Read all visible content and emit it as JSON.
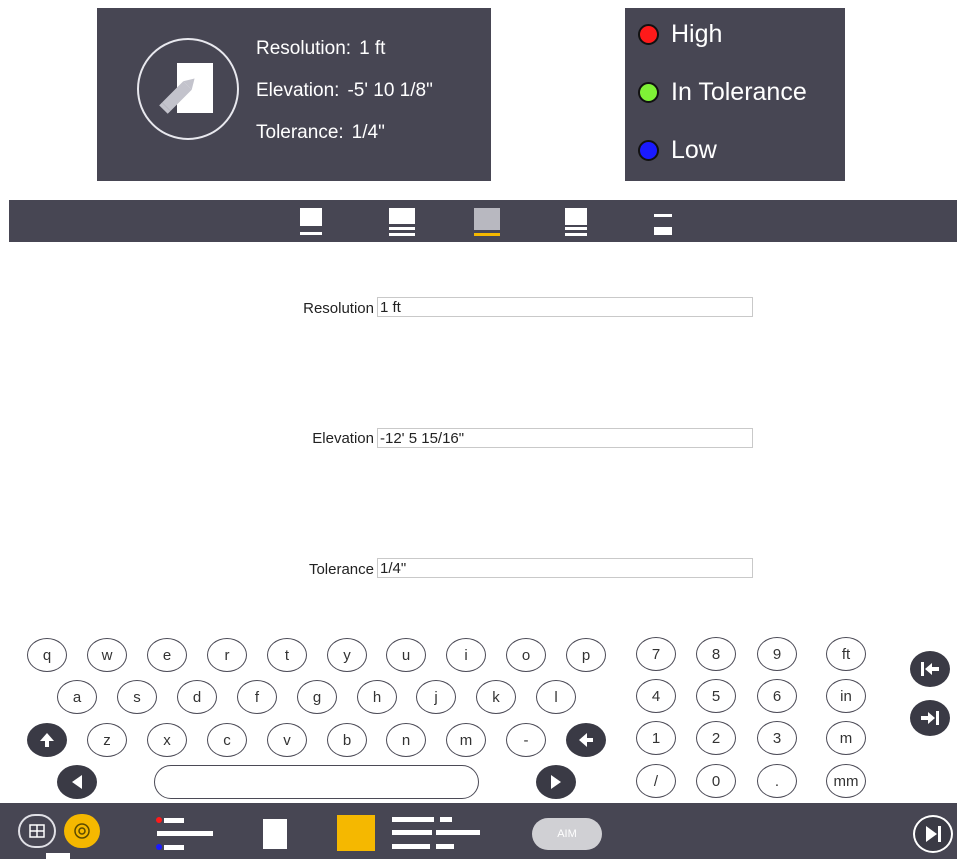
{
  "info_panel": {
    "resolution_label": "Resolution:",
    "resolution_value": "1 ft",
    "elevation_label": "Elevation:",
    "elevation_value": "-5' 10 1/8\"",
    "tolerance_label": "Tolerance:",
    "tolerance_value": "1/4\"",
    "icon": "edit-document-icon"
  },
  "legend": {
    "items": [
      {
        "label": "High",
        "color": "#ff1a1a"
      },
      {
        "label": "In Tolerance",
        "color": "#7ff236"
      },
      {
        "label": "Low",
        "color": "#1a1aff"
      }
    ]
  },
  "tabs": {
    "active_index": 2,
    "accent_color": "#f5b800",
    "icons": [
      "tab-icon-1",
      "tab-icon-2",
      "tab-icon-3",
      "tab-icon-4",
      "tab-icon-5"
    ]
  },
  "form": {
    "resolution_label": "Resolution",
    "resolution_value": "1 ft",
    "elevation_label": "Elevation",
    "elevation_value": "-12' 5 15/16\"",
    "tolerance_label": "Tolerance",
    "tolerance_value": "1/4\""
  },
  "keyboard": {
    "row1": [
      "q",
      "w",
      "e",
      "r",
      "t",
      "y",
      "u",
      "i",
      "o",
      "p"
    ],
    "row2": [
      "a",
      "s",
      "d",
      "f",
      "g",
      "h",
      "j",
      "k",
      "l"
    ],
    "row3": [
      "z",
      "x",
      "c",
      "v",
      "b",
      "n",
      "m",
      "-"
    ],
    "numpad": [
      "7",
      "8",
      "9",
      "ft",
      "4",
      "5",
      "6",
      "in",
      "1",
      "2",
      "3",
      "m",
      "/",
      "0",
      ".",
      "mm"
    ]
  },
  "bottombar": {
    "aim_label": "AIM",
    "accent_color": "#f5b800"
  }
}
